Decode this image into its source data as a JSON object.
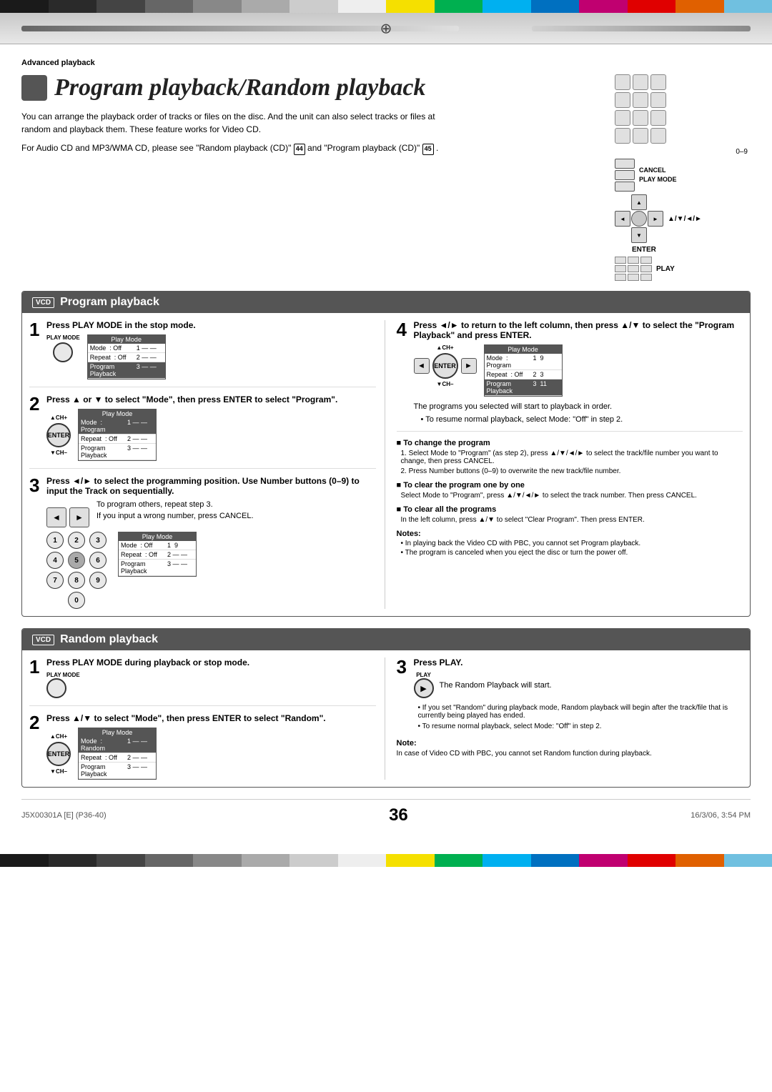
{
  "colors": {
    "topBar": [
      "#1a1a1a",
      "#2a2a2a",
      "#444",
      "#666",
      "#888",
      "#aaa",
      "#ccc",
      "#eee",
      "#f5e000",
      "#00b050",
      "#00b0f0",
      "#0070c0",
      "#c00070",
      "#e00000",
      "#e06000",
      "#70c0e0"
    ],
    "accent": "#555",
    "white": "#fff"
  },
  "header": {
    "section_label": "Advanced playback"
  },
  "title": "Program playback/Random playback",
  "intro": {
    "para1": "You can arrange the playback order of tracks or files on the disc. And the unit can also select tracks or files at random and playback them. These feature works for Video CD.",
    "para2": "For Audio CD and MP3/WMA CD, please see \"Random playback (CD)\"",
    "ref1": "44",
    "ref2": "and \"Program playback (CD)\"",
    "ref3": "45",
    "ref3end": "."
  },
  "remote": {
    "keys_label": "0–9",
    "cancel_label": "CANCEL",
    "play_mode_label": "PLAY MODE",
    "arrows_label": "▲/▼/◄/►",
    "enter_label": "ENTER",
    "play_label": "PLAY"
  },
  "program_section": {
    "title": "Program playback",
    "vcd_badge": "VCD",
    "steps": [
      {
        "num": "1",
        "instruction": "Press PLAY MODE in the stop mode.",
        "btn_label": "PLAY MODE",
        "screen": {
          "title": "Play Mode",
          "rows": [
            {
              "col1": "Mode",
              "col2": ": Off",
              "col3": "",
              "hl": false
            },
            {
              "col1": "Repeat",
              "col2": ": Off",
              "col3": "",
              "hl": false
            },
            {
              "col1": "Program Playback",
              "col2": "",
              "col3": "",
              "hl": true
            }
          ],
          "track_rows": [
            {
              "num": "1",
              "val": "— —"
            },
            {
              "num": "2",
              "val": "— —"
            },
            {
              "num": "3",
              "val": "— —"
            }
          ]
        }
      },
      {
        "num": "2",
        "instruction": "Press ▲ or ▼ to select \"Mode\", then press ENTER to select \"Program\".",
        "screen": {
          "title": "Play Mode",
          "rows": [
            {
              "col1": "Mode",
              "col2": ": Program",
              "hl": true
            },
            {
              "col1": "Repeat",
              "col2": ": Off",
              "hl": false
            },
            {
              "col1": "Program Playback",
              "col2": "",
              "hl": false
            }
          ],
          "track_rows": [
            {
              "num": "1",
              "val": "— —"
            },
            {
              "num": "2",
              "val": "— —"
            },
            {
              "num": "3",
              "val": "— —"
            }
          ]
        }
      },
      {
        "num": "3",
        "instruction": "Press ◄/► to select the programming position. Use Number buttons (0–9) to input the Track on sequentially.",
        "bullets": [
          "To program others, repeat step 3.",
          "If you input a wrong number, press CANCEL."
        ],
        "screen": {
          "title": "Play Mode",
          "rows": [
            {
              "col1": "Mode",
              "col2": ": Off",
              "hl": false
            },
            {
              "col1": "Repeat",
              "col2": ": Off",
              "hl": false
            },
            {
              "col1": "Program Playback",
              "col2": "",
              "hl": false
            }
          ],
          "track_rows": [
            {
              "num": "1",
              "val": "9"
            },
            {
              "num": "2",
              "val": "— —"
            },
            {
              "num": "3",
              "val": "— —"
            }
          ]
        }
      }
    ],
    "step4": {
      "num": "4",
      "instruction": "Press ◄/► to return to the left column, then press ▲/▼ to select the \"Program Playback\" and press ENTER.",
      "body1": "The programs you selected will start to playback in order.",
      "bullet1": "To resume normal playback, select Mode: \"Off\" in step 2.",
      "screen": {
        "title": "Play Mode",
        "rows": [
          {
            "col1": "Mode",
            "col2": ": Program",
            "hl": false
          },
          {
            "col1": "Repeat",
            "col2": ": Off",
            "hl": false
          },
          {
            "col1": "Program Playback",
            "col2": "",
            "hl": true
          }
        ],
        "track_rows": [
          {
            "num": "1",
            "val": "9"
          },
          {
            "num": "2",
            "val": "3"
          },
          {
            "num": "3",
            "val": "11"
          }
        ]
      }
    },
    "to_change": {
      "header": "■ To change the program",
      "step1": "1. Select Mode to \"Program\" (as step 2), press ▲/▼/◄/► to select the track/file number you want to change, then press CANCEL.",
      "step2": "2. Press Number buttons (0–9) to overwrite the new track/file number."
    },
    "to_clear_one": {
      "header": "■ To clear the program one by one",
      "body": "Select Mode to \"Program\", press ▲/▼/◄/► to select the track number. Then press CANCEL."
    },
    "to_clear_all": {
      "header": "■ To clear all the programs",
      "body": "In the left column, press ▲/▼ to select \"Clear Program\". Then press ENTER."
    },
    "notes": {
      "label": "Notes:",
      "items": [
        "In playing back the Video CD with PBC, you cannot set Program playback.",
        "The program is canceled when you eject the disc or turn the power off."
      ]
    }
  },
  "random_section": {
    "title": "Random playback",
    "vcd_badge": "VCD",
    "steps": [
      {
        "num": "1",
        "instruction": "Press PLAY MODE during playback or stop mode.",
        "btn_label": "PLAY MODE"
      },
      {
        "num": "2",
        "instruction": "Press ▲/▼ to select \"Mode\", then press ENTER to select \"Random\".",
        "screen": {
          "title": "Play Mode",
          "rows": [
            {
              "col1": "Mode",
              "col2": ": Random",
              "hl": true
            },
            {
              "col1": "Repeat",
              "col2": ": Off",
              "hl": false
            },
            {
              "col1": "Program Playback",
              "col2": "",
              "hl": false
            }
          ],
          "track_rows": [
            {
              "num": "1",
              "val": "— —"
            },
            {
              "num": "2",
              "val": "— —"
            },
            {
              "num": "3",
              "val": "— —"
            }
          ]
        }
      }
    ],
    "step3": {
      "num": "3",
      "instruction": "Press PLAY.",
      "btn_label": "PLAY",
      "body": "The Random Playback will start.",
      "bullets": [
        "If you set \"Random\" during playback mode, Random playback will begin after the track/file that is currently being played has ended.",
        "To resume normal playback, select Mode: \"Off\" in step 2."
      ]
    },
    "note": {
      "label": "Note:",
      "body": "In case of Video CD with PBC, you cannot set Random function during playback."
    }
  },
  "footer": {
    "left_code": "J5X00301A [E] (P36-40)",
    "page_num": "36",
    "right_text": "16/3/06, 3:54 PM"
  }
}
